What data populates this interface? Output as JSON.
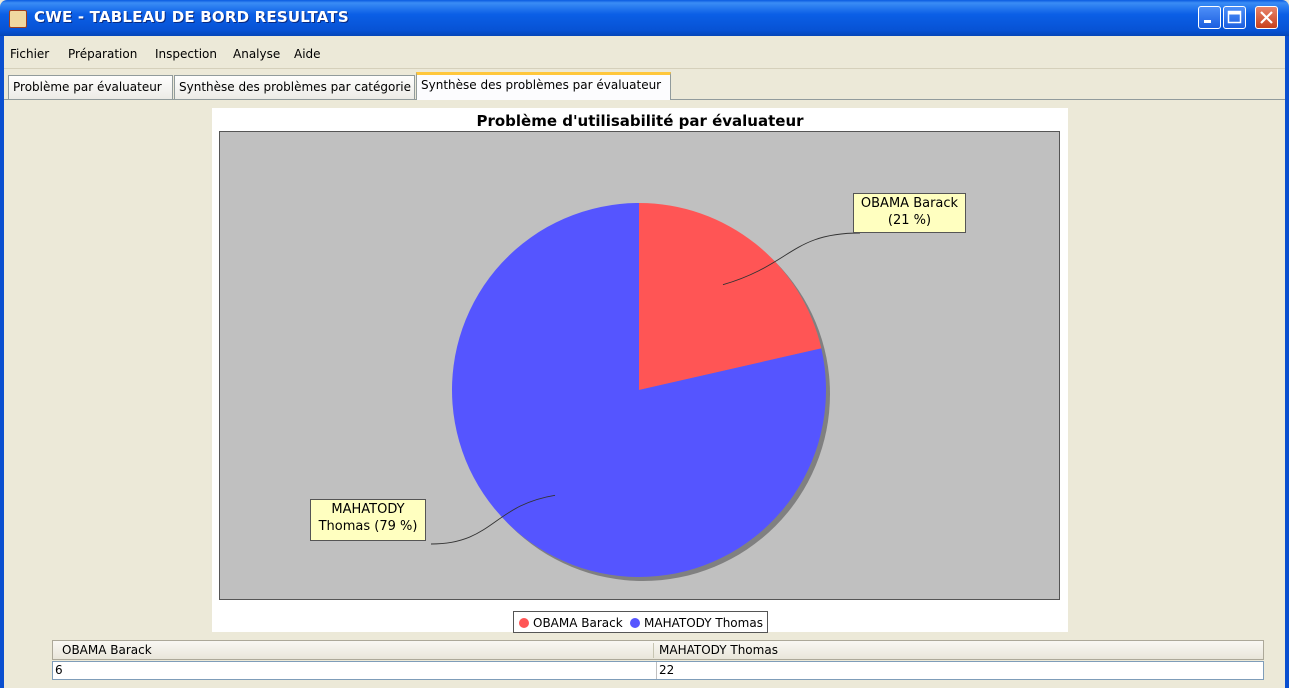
{
  "window": {
    "title": "CWE - TABLEAU DE BORD RESULTATS"
  },
  "menu": [
    "Fichier",
    "Préparation",
    "Inspection",
    "Analyse",
    "Aide"
  ],
  "tabs": [
    {
      "label": "Problème par évaluateur",
      "active": false
    },
    {
      "label": "Synthèse des problèmes par catégorie",
      "active": false
    },
    {
      "label": "Synthèse des problèmes par évaluateur",
      "active": true
    }
  ],
  "chart_data": {
    "type": "pie",
    "title": "Problème d'utilisabilité par évaluateur",
    "slices": [
      {
        "name": "OBAMA Barack",
        "value": 6,
        "label": "OBAMA Barack (21 %)",
        "color": "#ff5555"
      },
      {
        "name": "MAHATODY Thomas",
        "value": 22,
        "label": "MAHATODY Thomas (79 %)",
        "color": "#5555ff"
      }
    ],
    "legend": [
      "OBAMA Barack",
      "MAHATODY Thomas"
    ],
    "legend_placement": "bottom",
    "plot_background": "#c0c0c0"
  },
  "label_lines": {
    "obama": [
      "OBAMA Barack",
      "(21 %)"
    ],
    "mahatody": [
      "MAHATODY",
      "Thomas (79 %)"
    ]
  },
  "table": {
    "headers": [
      "OBAMA Barack",
      "MAHATODY Thomas"
    ],
    "rows": [
      [
        "6",
        "22"
      ]
    ]
  }
}
